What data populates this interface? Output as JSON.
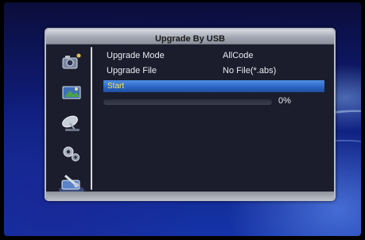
{
  "dialog": {
    "title": "Upgrade By USB"
  },
  "menu": {
    "icons": [
      "media-icon",
      "picture-icon",
      "satellite-dish-icon",
      "gears-settings-icon",
      "usb-tools-icon"
    ],
    "selected_icon": "usb-tools-icon"
  },
  "rows": [
    {
      "label": "Upgrade Mode",
      "value": "AllCode"
    },
    {
      "label": "Upgrade File",
      "value": "No File(*.abs)"
    }
  ],
  "start": {
    "label": "Start"
  },
  "progress": {
    "fraction": 0,
    "text": "0%"
  },
  "colors": {
    "highlight": "#2a63c4",
    "highlight_text": "#ffe94a",
    "panel": "#1b1d2c",
    "title_bar": "#a3a8b3"
  }
}
